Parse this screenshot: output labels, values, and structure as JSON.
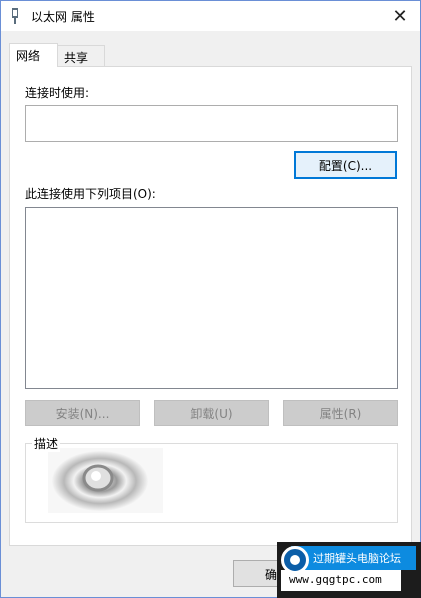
{
  "window": {
    "title": "以太网 属性",
    "close_glyph": "✕"
  },
  "tabs": [
    {
      "label": "网络",
      "active": true
    },
    {
      "label": "共享",
      "active": false
    }
  ],
  "network": {
    "connect_using_label": "连接时使用:",
    "adapter_value": "",
    "configure_button": "配置(C)...",
    "items_label": "此连接使用下列项目(O):",
    "items": [],
    "install_button": "安装(N)...",
    "uninstall_button": "卸载(U)",
    "properties_button": "属性(R)",
    "description_legend": "描述",
    "description_text": ""
  },
  "footer": {
    "ok_button": "确"
  },
  "watermark": {
    "line1": "过期罐头电脑论坛",
    "line2": "www.gqgtpc.com"
  },
  "colors": {
    "accent": "#0078d7",
    "window_border": "#6a8fd6",
    "watermark_blue": "#0d8be0"
  }
}
